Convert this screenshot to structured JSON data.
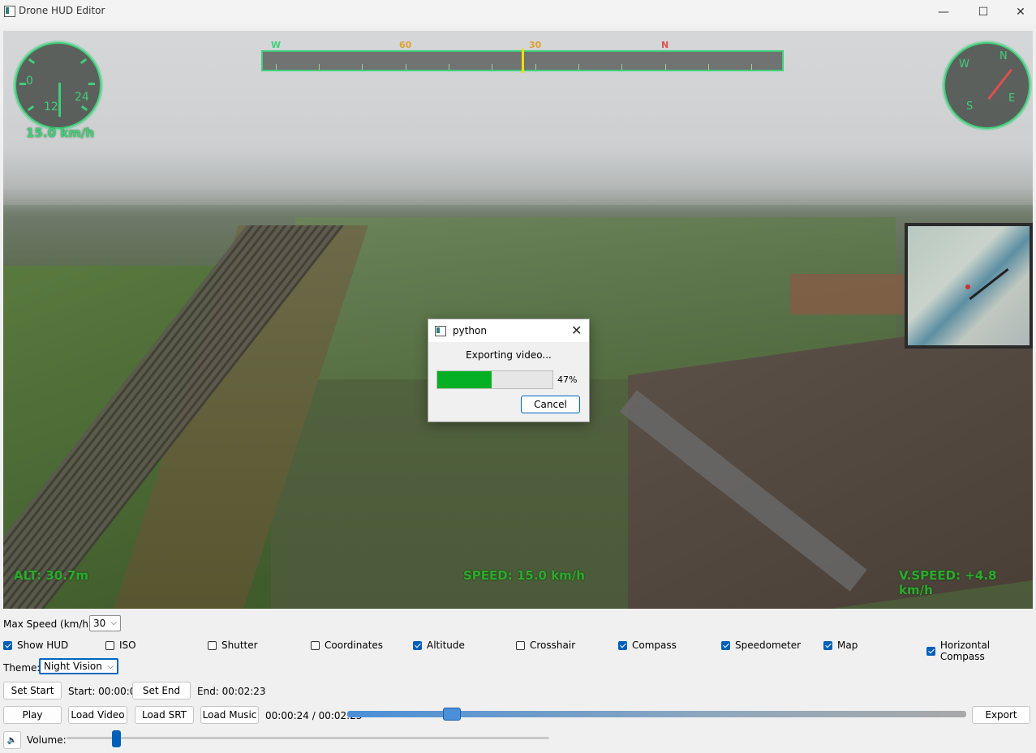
{
  "window": {
    "title": "Drone HUD Editor",
    "minimize_glyph": "—",
    "maximize_glyph": "☐",
    "close_glyph": "✕"
  },
  "hud": {
    "speedometer": {
      "labels": [
        "0",
        "12",
        "24"
      ],
      "value_text": "15.0 km/h"
    },
    "horizontal_compass": {
      "labels": [
        "W",
        "60",
        "30",
        "N"
      ]
    },
    "compass": {
      "labels": [
        "N",
        "W",
        "E",
        "S"
      ]
    },
    "altitude_text": "ALT: 30.7m",
    "speed_text": "SPEED: 15.0 km/h",
    "vspeed_text": "V.SPEED: +4.8 km/h"
  },
  "export_dialog": {
    "title": "python",
    "close_glyph": "✕",
    "message": "Exporting video...",
    "progress": 0.47,
    "progress_text": "47%",
    "cancel_label": "Cancel"
  },
  "controls": {
    "max_speed_label": "Max Speed (km/h):",
    "max_speed_value": "30",
    "checkboxes": [
      {
        "label": "Show HUD",
        "checked": true
      },
      {
        "label": "ISO",
        "checked": false
      },
      {
        "label": "Shutter",
        "checked": false
      },
      {
        "label": "Coordinates",
        "checked": false
      },
      {
        "label": "Altitude",
        "checked": true
      },
      {
        "label": "Crosshair",
        "checked": false
      },
      {
        "label": "Compass",
        "checked": true
      },
      {
        "label": "Speedometer",
        "checked": true
      },
      {
        "label": "Map",
        "checked": true
      },
      {
        "label": "Horizontal Compass",
        "checked": true
      }
    ],
    "theme_label": "Theme:",
    "theme_value": "Night Vision",
    "set_start_label": "Set Start",
    "start_text": "Start: 00:00:00",
    "set_end_label": "Set End",
    "end_text": "End: 00:02:23",
    "play_label": "Play",
    "load_video_label": "Load Video",
    "load_srt_label": "Load SRT",
    "load_music_label": "Load Music",
    "time_text": "00:00:24 / 00:02:23",
    "playback_position": 0.168,
    "export_label": "Export",
    "volume_label": "Volume:",
    "volume_level": 0.1
  },
  "colors": {
    "hud_green": "#3fcf7a",
    "hud_text_green": "#2fa82f",
    "progress_green": "#06b025",
    "accent_blue": "#005fb8"
  }
}
